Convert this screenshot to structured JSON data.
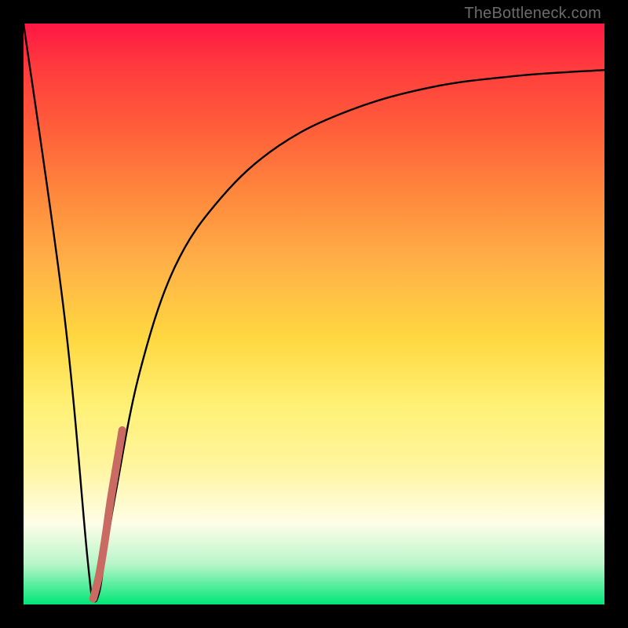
{
  "watermark": "TheBottleneck.com",
  "chart_data": {
    "type": "line",
    "title": "",
    "xlabel": "",
    "ylabel": "",
    "xlim": [
      0,
      100
    ],
    "ylim": [
      0,
      100
    ],
    "grid": false,
    "series": [
      {
        "name": "black-curve",
        "color": "#000000",
        "x": [
          0,
          7,
          11,
          12,
          13,
          14,
          16,
          20,
          26,
          34,
          44,
          56,
          70,
          85,
          100
        ],
        "values": [
          100,
          50,
          8,
          1,
          2,
          8,
          20,
          40,
          58,
          70,
          79,
          85,
          89,
          91,
          92
        ]
      },
      {
        "name": "red-highlight",
        "color": "#c96a63",
        "x": [
          12,
          13,
          14,
          15,
          16,
          17
        ],
        "values": [
          1,
          5,
          11,
          18,
          24,
          30
        ]
      }
    ],
    "colors": {
      "highlight": "#c96a63",
      "curve": "#000000"
    },
    "background_gradient": [
      "#ff1744",
      "#ff8a3d",
      "#ffd740",
      "#fff59d",
      "#00e676"
    ]
  }
}
